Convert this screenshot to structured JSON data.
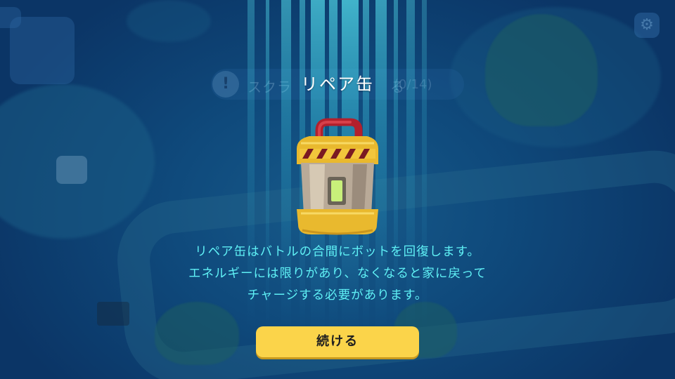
{
  "modal": {
    "title": "リペア缶",
    "item_icon": "repair-can-icon",
    "description_lines": [
      "リペア缶はバトルの合間にボットを回復します。",
      "エネルギーには限りがあり、なくなると家に戻って",
      "チャージする必要があります。"
    ],
    "continue_label": "続ける"
  },
  "background_hud": {
    "quest_text": "スクラ",
    "quest_text_tail": "る",
    "quest_count": "(0/14)",
    "settings_icon": "gear-icon"
  },
  "colors": {
    "background": "#0f4a7c",
    "title_text": "#ffffff",
    "description_text": "#5ff0f5",
    "button_fill": "#fbd44a",
    "button_text": "#1f1f1f",
    "can_band": "#f2c63c",
    "can_handle": "#c12a35",
    "can_stripe": "#7a1a22",
    "can_window": "#c8f07a"
  }
}
